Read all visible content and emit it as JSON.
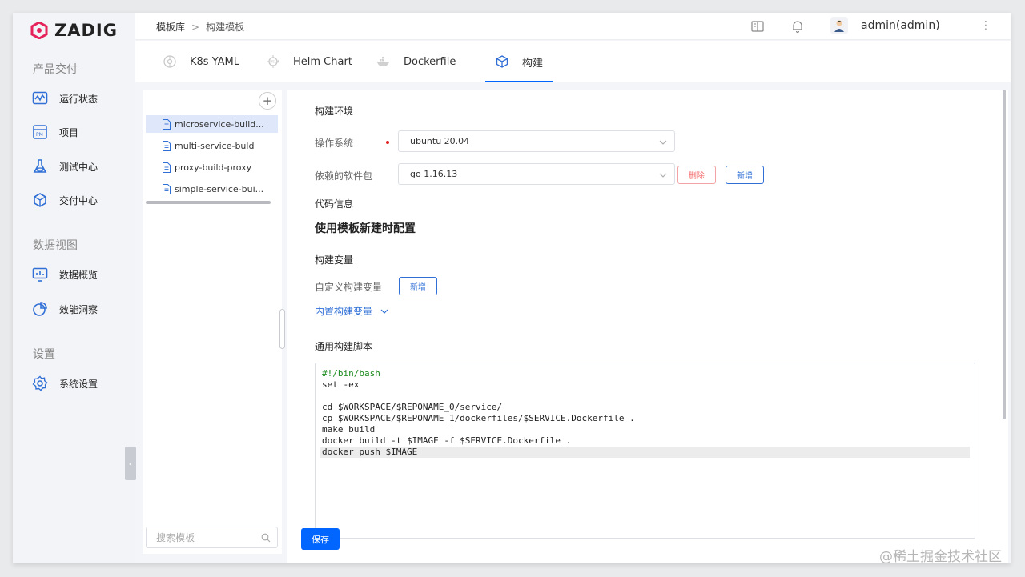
{
  "app": {
    "logo_text": "ZADIG",
    "brand_color": "#e5225a",
    "accent_color": "#0066ff"
  },
  "sidebar": {
    "groups": [
      {
        "title": "产品交付"
      },
      {
        "title": "数据视图"
      },
      {
        "title": "设置"
      }
    ],
    "items": [
      {
        "label": "运行状态",
        "icon": "pulse-monitor-icon"
      },
      {
        "label": "项目",
        "icon": "project-board-icon"
      },
      {
        "label": "测试中心",
        "icon": "flask-icon"
      },
      {
        "label": "交付中心",
        "icon": "package-icon"
      },
      {
        "label": "数据概览",
        "icon": "dashboard-chart-icon"
      },
      {
        "label": "效能洞察",
        "icon": "pie-chart-icon"
      },
      {
        "label": "系统设置",
        "icon": "gear-icon"
      }
    ],
    "collapse_glyph": "‹"
  },
  "topbar": {
    "breadcrumb": [
      "模板库",
      "构建模板"
    ],
    "breadcrumb_sep": ">",
    "user_name": "admin(admin)",
    "more_glyph": "⋮"
  },
  "tabs": [
    {
      "label": "K8s YAML",
      "icon": "k8s-icon"
    },
    {
      "label": "Helm Chart",
      "icon": "helm-icon"
    },
    {
      "label": "Dockerfile",
      "icon": "docker-icon"
    },
    {
      "label": "构建",
      "icon": "cube-icon",
      "active": true
    }
  ],
  "templates": {
    "add_glyph": "+",
    "items": [
      {
        "label": "microservice-build...",
        "selected": true
      },
      {
        "label": "multi-service-buld"
      },
      {
        "label": "proxy-build-proxy"
      },
      {
        "label": "simple-service-bui..."
      }
    ],
    "search_placeholder": "搜索模板"
  },
  "form": {
    "build_env_title": "构建环境",
    "os_label": "操作系统",
    "os_value": "ubuntu 20.04",
    "deps_label": "依赖的软件包",
    "deps_value": "go 1.16.13",
    "delete_label": "删除",
    "add_label": "新增",
    "code_info_title": "代码信息",
    "code_info_text": "使用模板新建时配置",
    "build_vars_title": "构建变量",
    "custom_vars_label": "自定义构建变量",
    "custom_vars_add": "新增",
    "builtin_vars_link": "内置构建变量",
    "script_title": "通用构建脚本",
    "script_lines": [
      "#!/bin/bash",
      "set -ex",
      "",
      "cd $WORKSPACE/$REPONAME_0/service/",
      "cp $WORKSPACE/$REPONAME_1/dockerfiles/$SERVICE.Dockerfile .",
      "make build",
      "docker build -t $IMAGE -f $SERVICE.Dockerfile .",
      "docker push $IMAGE"
    ],
    "save_label": "保存"
  },
  "watermark": "@稀土掘金技术社区"
}
